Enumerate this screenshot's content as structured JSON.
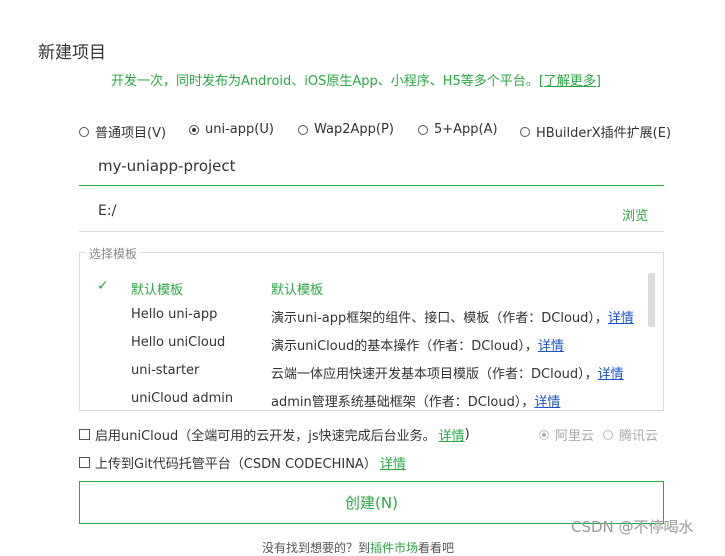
{
  "header": {
    "title": "新建项目",
    "subtitle": "开发一次，同时发布为Android、iOS原生App、小程序、H5等多个平台。",
    "learn_more": "[了解更多]"
  },
  "project_types": [
    {
      "label": "普通项目(V)",
      "selected": false
    },
    {
      "label": "uni-app(U)",
      "selected": true
    },
    {
      "label": "Wap2App(P)",
      "selected": false
    },
    {
      "label": "5+App(A)",
      "selected": false
    },
    {
      "label": "HBuilderX插件扩展(E)",
      "selected": false
    }
  ],
  "project_name": {
    "value": "my-uniapp-project"
  },
  "project_path": {
    "value": "E:/",
    "browse_label": "浏览"
  },
  "templates": {
    "legend": "选择模板",
    "rows": [
      {
        "name": "默认模板",
        "desc": "默认模板",
        "link": "",
        "selected": true
      },
      {
        "name": "Hello uni-app",
        "desc": "演示uni-app框架的组件、接口、模板（作者：DCloud），",
        "link": "详情",
        "selected": false
      },
      {
        "name": "Hello uniCloud",
        "desc": "演示uniCloud的基本操作（作者：DCloud），",
        "link": "详情",
        "selected": false
      },
      {
        "name": "uni-starter",
        "desc": "云端一体应用快速开发基本项目模版（作者：DCloud），",
        "link": "详情",
        "selected": false
      },
      {
        "name": "uniCloud admin",
        "desc": "admin管理系统基础框架（作者：DCloud），",
        "link": "详情",
        "selected": false
      }
    ]
  },
  "options": {
    "unicloud": {
      "label": "启用uniCloud（全端可用的云开发，js快速完成后台业务。",
      "detail": "详情",
      "suffix": ")"
    },
    "cloud_providers": [
      {
        "label": "阿里云",
        "selected": true
      },
      {
        "label": "腾讯云",
        "selected": false
      }
    ],
    "git": {
      "label": "上传到Git代码托管平台（CSDN CODECHINA）",
      "detail": "详情"
    }
  },
  "create_button": "创建(N)",
  "bottom_hint": {
    "prefix": "没有找到想要的？到",
    "plugin": "插件市场",
    "suffix": "看看吧"
  },
  "watermark": "CSDN @不停喝水",
  "colors": {
    "accent": "#2aa844",
    "link": "#1a55c9"
  }
}
